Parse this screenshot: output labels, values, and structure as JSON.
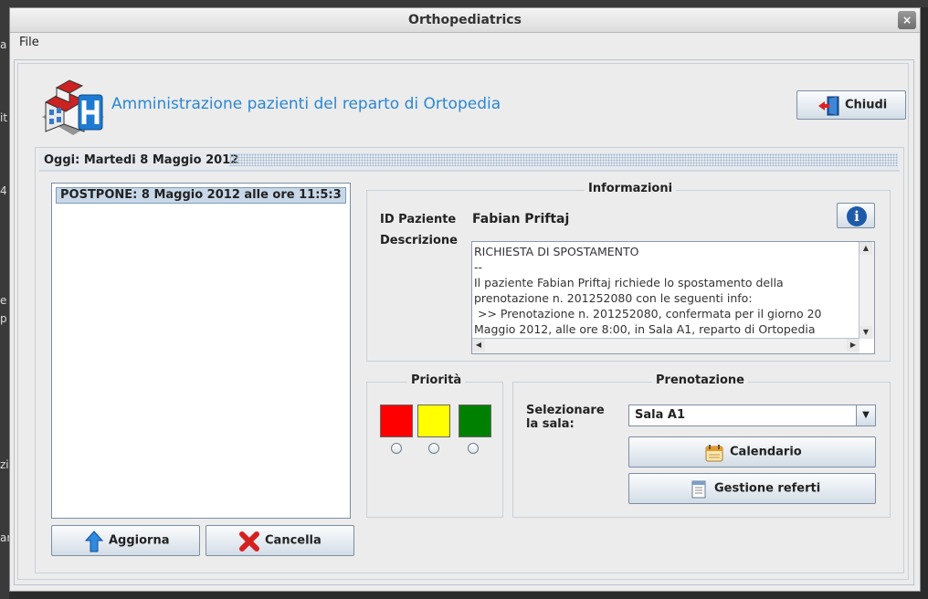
{
  "window": {
    "title": "Orthopediatrics",
    "close_glyph": "×"
  },
  "menu": {
    "file": "File"
  },
  "header": {
    "title": "Amministrazione pazienti del reparto di Ortopedia",
    "close_button": "Chiudi",
    "logo_icon": "hospital-building-icon"
  },
  "date_bar": {
    "text": "Oggi: Martedi 8 Maggio 2012"
  },
  "list": {
    "items": [
      "POSTPONE: 8 Maggio 2012 alle ore 11:5:3"
    ]
  },
  "buttons": {
    "refresh": "Aggiorna",
    "delete": "Cancella"
  },
  "info": {
    "title": "Informazioni",
    "patient_id_label": "ID Paziente",
    "patient_name": "Fabian Priftaj",
    "description_label": "Descrizione",
    "description": "RICHIESTA DI SPOSTAMENTO\n--\nIl paziente Fabian Priftaj richiede lo spostamento della\nprenotazione n. 201252080 con le seguenti info:\n >> Prenotazione n. 201252080, confermata per il giorno 20\nMaggio 2012, alle ore 8:00, in Sala A1, reparto di Ortopedia"
  },
  "priority": {
    "title": "Priorità",
    "colors": [
      "#ff0000",
      "#ffff00",
      "#008000"
    ]
  },
  "booking": {
    "title": "Prenotazione",
    "room_label": "Selezionare\nla sala:",
    "room_value": "Sala A1",
    "calendar_button": "Calendario",
    "reports_button": "Gestione referti"
  },
  "desktop": {
    "glyphs": [
      "a",
      "it",
      "4",
      "e",
      "p",
      "zi",
      "ar"
    ]
  }
}
